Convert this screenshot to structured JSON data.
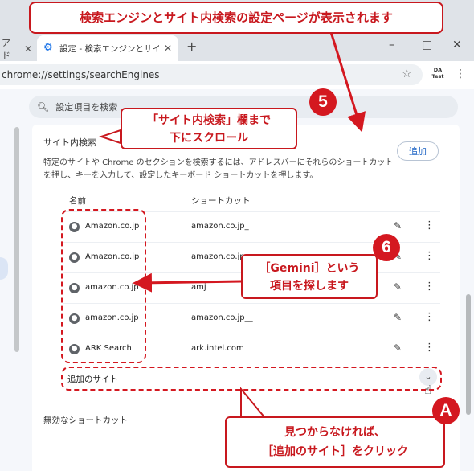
{
  "browser": {
    "prev_tab_label": "アド",
    "active_tab_title": "設定 - 検索エンジンとサイト内検索",
    "url": "chrome://settings/searchEngines",
    "profile_lines": [
      "DA",
      "Test"
    ],
    "window_controls": [
      "–",
      "□",
      "✕"
    ],
    "icons": [
      "gear-icon",
      "close-icon",
      "plus-icon",
      "star-icon",
      "kebab-icon"
    ]
  },
  "settings": {
    "search_placeholder": "設定項目を検索",
    "section_title": "サイト内検索",
    "add_button": "追加",
    "description": "特定のサイトや Chrome のセクションを検索するには、アドレスバーにそれらのショートカットを押し、キーを入力して、設定したキーボード ショートカットを押します。",
    "columns": {
      "name": "名前",
      "shortcut": "ショートカット"
    },
    "rows": [
      {
        "name": "Amazon.co.jp",
        "shortcut": "amazon.co.jp_"
      },
      {
        "name": "Amazon.co.jp",
        "shortcut": "amazon.co.jp"
      },
      {
        "name": "amazon.co.jp",
        "shortcut": "amj"
      },
      {
        "name": "amazon.co.jp",
        "shortcut": "amazon.co.jp__"
      },
      {
        "name": "ARK Search",
        "shortcut": "ark.intel.com"
      }
    ],
    "additional_sites_label": "追加のサイト",
    "inactive_shortcuts_label": "無効なショートカット"
  },
  "annotations": {
    "top": "検索エンジンとサイト内検索の設定ページが表示されます",
    "step5_badge": "5",
    "step5_lines": [
      "「サイト内検索」欄まで",
      "下にスクロール"
    ],
    "step6_badge": "6",
    "step6_lines": [
      "［Gemini］という",
      "項目を探します"
    ],
    "stepA_badge": "A",
    "stepA_lines": [
      "見つからなければ、",
      "［追加のサイト］をクリック"
    ],
    "accent_color": "#d41820"
  }
}
